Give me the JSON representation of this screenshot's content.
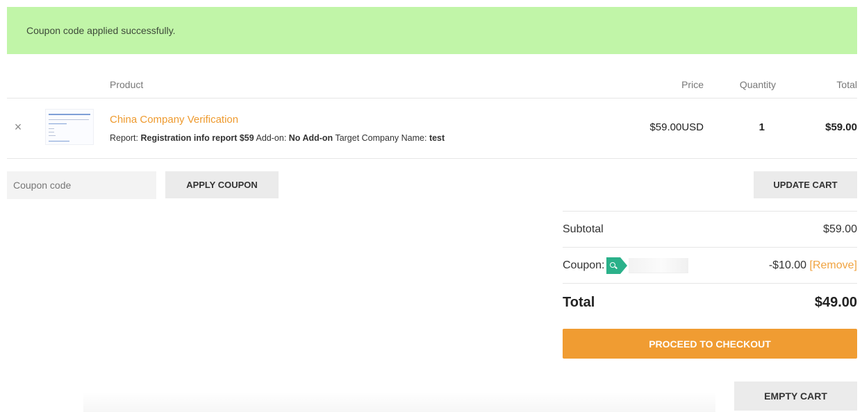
{
  "notice": {
    "message": "Coupon code applied successfully."
  },
  "cart": {
    "headers": {
      "product": "Product",
      "price": "Price",
      "quantity": "Quantity",
      "total": "Total"
    },
    "items": [
      {
        "name": "China Company Verification",
        "meta_report_label": "Report:",
        "meta_report_value": "Registration info report $59",
        "meta_addon_label": "Add-on:",
        "meta_addon_value": "No Add-on",
        "meta_target_label": "Target Company Name:",
        "meta_target_value": "test",
        "price": "$59.00USD",
        "quantity": "1",
        "total": "$59.00"
      }
    ]
  },
  "coupon": {
    "placeholder": "Coupon code",
    "apply_label": "APPLY COUPON"
  },
  "update_label": "UPDATE CART",
  "totals": {
    "subtotal_label": "Subtotal",
    "subtotal_value": "$59.00",
    "coupon_label": "Coupon:",
    "coupon_amount": "-$10.00",
    "coupon_remove": "[Remove]",
    "total_label": "Total",
    "total_value": "$49.00"
  },
  "checkout_label": "PROCEED TO CHECKOUT",
  "empty_label": "EMPTY CART",
  "colors": {
    "accent": "#f09c32",
    "notice_bg": "#c1f5a8",
    "tag": "#2bb18a"
  }
}
